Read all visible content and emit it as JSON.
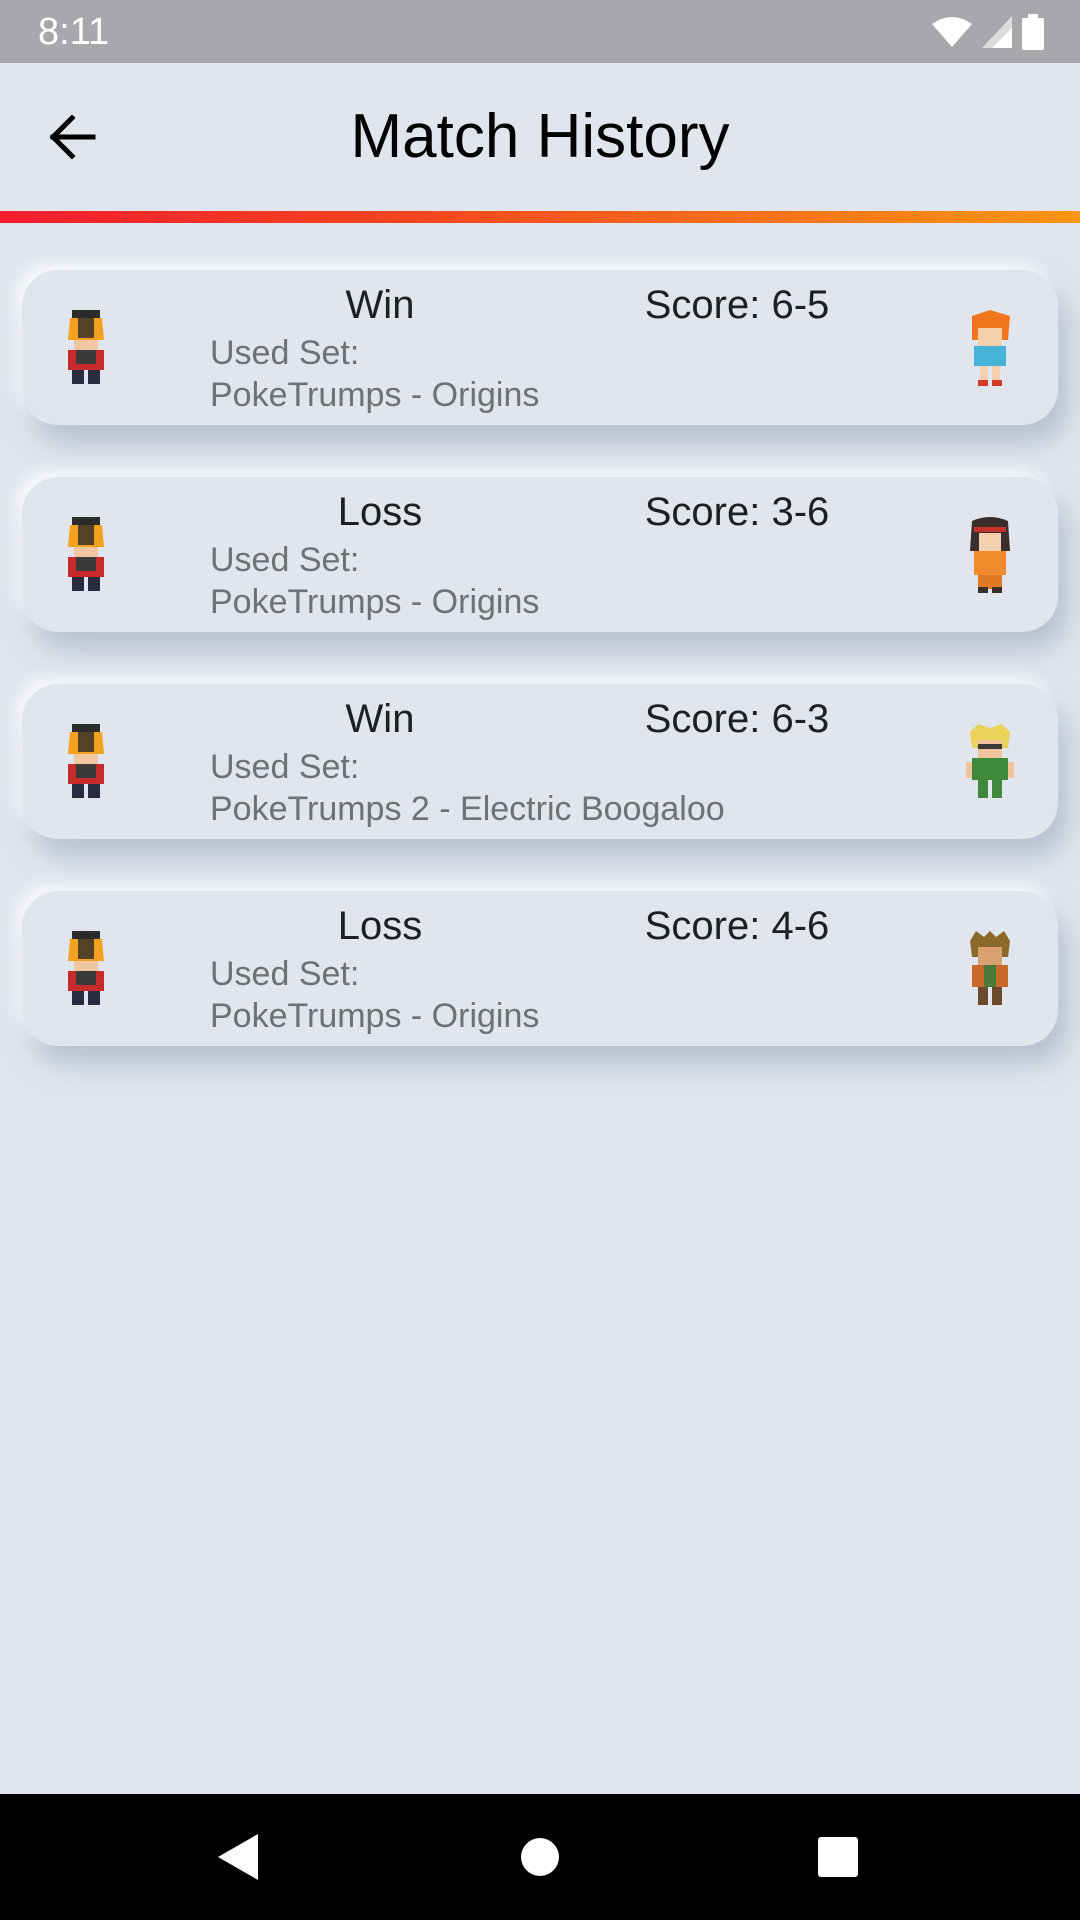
{
  "status_bar": {
    "time": "8:11",
    "icons": [
      "wifi-icon",
      "signal-icon",
      "battery-icon"
    ]
  },
  "header": {
    "title": "Match History",
    "back_icon": "arrow-back-icon"
  },
  "colors": {
    "background": "#e1e5ed",
    "accent_gradient": [
      "#f21d2f",
      "#fb9512"
    ],
    "status_bar": "#a6a8ac",
    "nav_bar": "#000000"
  },
  "matches": [
    {
      "result": "Win",
      "score": "Score: 6-5",
      "set_label": "Used Set:",
      "set_name": "PokeTrumps - Origins",
      "player_sprite": "trainer-gold-sprite",
      "opponent_sprite": "trainer-misty-sprite"
    },
    {
      "result": "Loss",
      "score": "Score: 3-6",
      "set_label": "Used Set:",
      "set_name": "PokeTrumps - Origins",
      "player_sprite": "trainer-gold-sprite",
      "opponent_sprite": "trainer-erika-sprite"
    },
    {
      "result": "Win",
      "score": "Score: 6-3",
      "set_label": "Used Set:",
      "set_name": "PokeTrumps 2 - Electric Boogaloo",
      "player_sprite": "trainer-gold-sprite",
      "opponent_sprite": "trainer-surge-sprite"
    },
    {
      "result": "Loss",
      "score": "Score: 4-6",
      "set_label": "Used Set:",
      "set_name": "PokeTrumps - Origins",
      "player_sprite": "trainer-gold-sprite",
      "opponent_sprite": "trainer-brock-sprite"
    }
  ],
  "nav_bar": {
    "icons": [
      "back-triangle-icon",
      "home-circle-icon",
      "recents-square-icon"
    ]
  }
}
